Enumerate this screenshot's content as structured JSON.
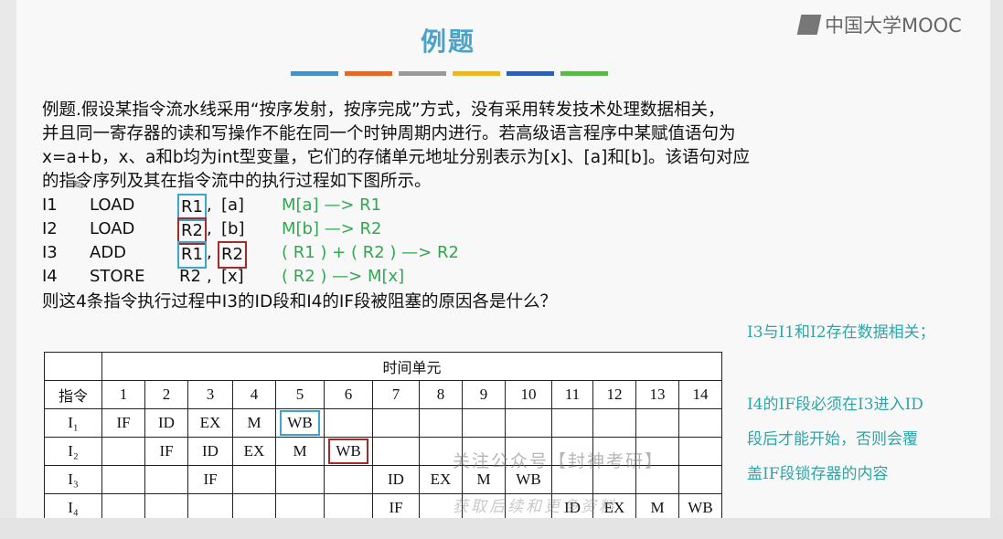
{
  "title": "例题",
  "logo_text": "中国大学MOOC",
  "stripes": [
    "#4a90c2",
    "#e06a2a",
    "#9a9a9a",
    "#e8b825",
    "#2f5fb0",
    "#5cb84a"
  ],
  "problem": [
    "例题.假设某指令流水线采用“按序发射，按序完成”方式，没有采用转发技术处理数据相关，",
    "并且同一寄存器的读和写操作不能在同一个时钟周期内进行。若高级语言程序中某赋值语句为",
    "x=a+b，x、a和b均为int型变量，它们的存储单元地址分别表示为[x]、[a]和[b]。该语句对应",
    "的指令序列及其在指令流中的执行过程如下图所示。"
  ],
  "instructions": [
    {
      "id": "I1",
      "op": "LOAD",
      "r1": "R1",
      "sep": ",",
      "r2": "[a]",
      "note": "M[a] —> R1"
    },
    {
      "id": "I2",
      "op": "LOAD",
      "r1": "R2",
      "sep": ",",
      "r2": "[b]",
      "note": "M[b] —> R2"
    },
    {
      "id": "I3",
      "op": "ADD",
      "r1": "R1",
      "sep": ",",
      "r2": "R2",
      "note": "( R1 ) + ( R2 ) —> R2"
    },
    {
      "id": "I4",
      "op": "STORE",
      "r1": "R2",
      "sep": ",",
      "r2": "[x]",
      "note": "( R2 ) —> M[x]"
    }
  ],
  "question": "则这4条指令执行过程中I3的ID段和I4的IF段被阻塞的原因各是什么？",
  "answers": {
    "a1": "I3与I1和I2存在数据相关；",
    "a2_lines": [
      "I4的IF段必须在I3进入ID",
      "段后才能开始，否则会覆",
      "盖IF段锁存器的内容"
    ]
  },
  "table": {
    "time_header": "时间单元",
    "instr_header": "指令",
    "cols": [
      "1",
      "2",
      "3",
      "4",
      "5",
      "6",
      "7",
      "8",
      "9",
      "10",
      "11",
      "12",
      "13",
      "14"
    ],
    "rows": [
      {
        "label": "I₁",
        "cells": [
          "IF",
          "ID",
          "EX",
          "M",
          "WB",
          "",
          "",
          "",
          "",
          "",
          "",
          "",
          "",
          ""
        ]
      },
      {
        "label": "I₂",
        "cells": [
          "",
          "IF",
          "ID",
          "EX",
          "M",
          "WB",
          "",
          "",
          "",
          "",
          "",
          "",
          "",
          ""
        ]
      },
      {
        "label": "I₃",
        "cells": [
          "",
          "",
          "IF",
          "",
          "",
          "",
          "ID",
          "EX",
          "M",
          "WB",
          "",
          "",
          "",
          ""
        ]
      },
      {
        "label": "I₄",
        "cells": [
          "",
          "",
          "",
          "",
          "",
          "",
          "IF",
          "",
          "",
          "",
          "ID",
          "EX",
          "M",
          "WB"
        ]
      }
    ]
  },
  "watermark": "关注公众号【封神考研】",
  "watermark2": "获取后续和更多资料"
}
